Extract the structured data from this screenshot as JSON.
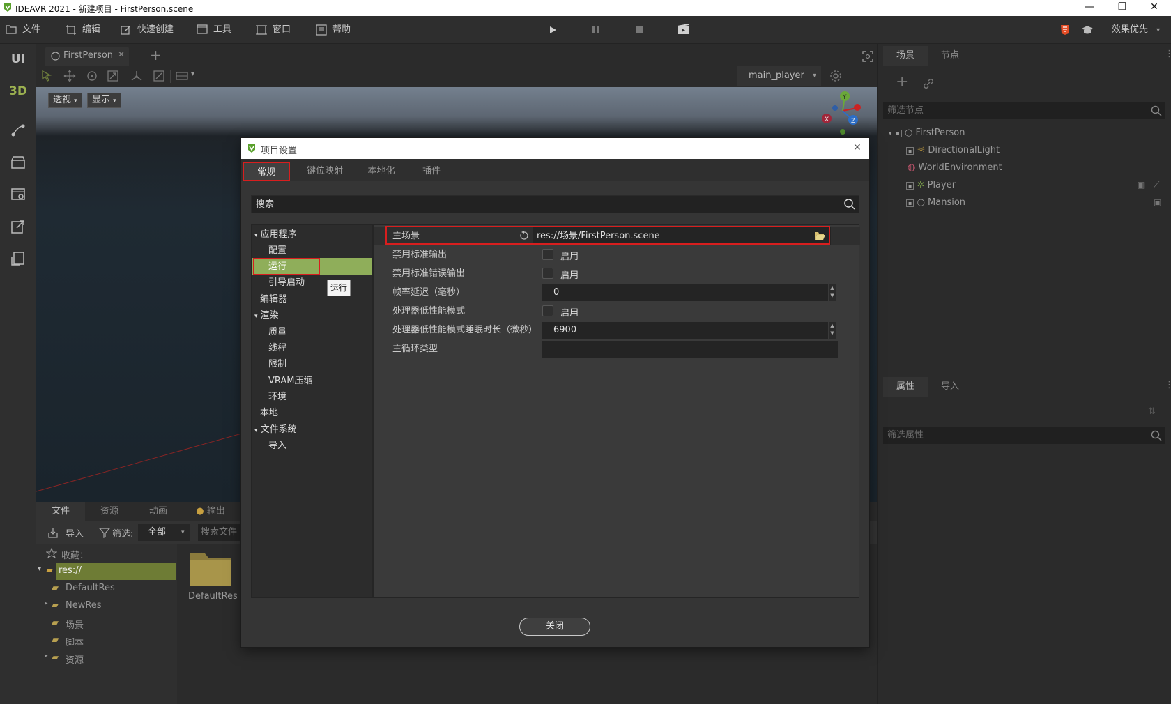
{
  "window": {
    "title": "IDEAVR 2021 - 新建项目 - FirstPerson.scene",
    "min": "—",
    "max": "❐",
    "close": "✕"
  },
  "menubar": {
    "items": [
      "文件",
      "编辑",
      "快速创建",
      "工具",
      "窗口",
      "帮助"
    ],
    "quality_label": "效果优先"
  },
  "leftrail": {
    "ui": "UI",
    "d3": "3D"
  },
  "viewport": {
    "tab_label": "FirstPerson",
    "add_tab": "+",
    "view_btn": "透视",
    "display_btn": "显示",
    "camera_select": "main_player"
  },
  "bottom": {
    "tabs": [
      "文件",
      "资源",
      "动画",
      "输出"
    ],
    "import_label": "导入",
    "filter_label": "筛选:",
    "filter_value": "全部",
    "search_placeholder": "搜索文件",
    "favorites_label": "收藏：",
    "tree": [
      "res://",
      "DefaultRes",
      "NewRes",
      "场景",
      "脚本",
      "资源"
    ],
    "folder_label": "DefaultRes"
  },
  "scene_dock": {
    "tabs": [
      "场景",
      "节点"
    ],
    "filter_placeholder": "筛选节点",
    "nodes": [
      "FirstPerson",
      "DirectionalLight",
      "WorldEnvironment",
      "Player",
      "Mansion"
    ]
  },
  "inspector_dock": {
    "tabs": [
      "属性",
      "导入"
    ],
    "filter_placeholder": "筛选属性"
  },
  "dialog": {
    "title": "项目设置",
    "close": "✕",
    "tabs": [
      "常规",
      "键位映射",
      "本地化",
      "插件"
    ],
    "search_placeholder": "搜索",
    "categories": [
      {
        "label": "应用程序",
        "level": 0,
        "expanded": true
      },
      {
        "label": "配置",
        "level": 1
      },
      {
        "label": "运行",
        "level": 1,
        "selected": true
      },
      {
        "label": "引导启动",
        "level": 1
      },
      {
        "label": "编辑器",
        "level": 0
      },
      {
        "label": "渲染",
        "level": 0,
        "expanded": true
      },
      {
        "label": "质量",
        "level": 1
      },
      {
        "label": "线程",
        "level": 1
      },
      {
        "label": "限制",
        "level": 1
      },
      {
        "label": "VRAM压缩",
        "level": 1
      },
      {
        "label": "环境",
        "level": 1
      },
      {
        "label": "本地",
        "level": 0
      },
      {
        "label": "文件系统",
        "level": 0,
        "expanded": true
      },
      {
        "label": "导入",
        "level": 1
      }
    ],
    "tooltip": "运行",
    "props": {
      "main_scene_label": "主场景",
      "main_scene_value": "res://场景/FirstPerson.scene",
      "disable_stdout_label": "禁用标准输出",
      "disable_stdout_value": "启用",
      "disable_stderr_label": "禁用标准错误输出",
      "disable_stderr_value": "启用",
      "frame_delay_label": "帧率延迟（毫秒）",
      "frame_delay_value": "0",
      "low_cpu_label": "处理器低性能模式",
      "low_cpu_value": "启用",
      "low_cpu_sleep_label": "处理器低性能模式睡眠时长（微秒）",
      "low_cpu_sleep_value": "6900",
      "main_loop_label": "主循环类型",
      "main_loop_value": ""
    },
    "close_button": "关闭"
  }
}
